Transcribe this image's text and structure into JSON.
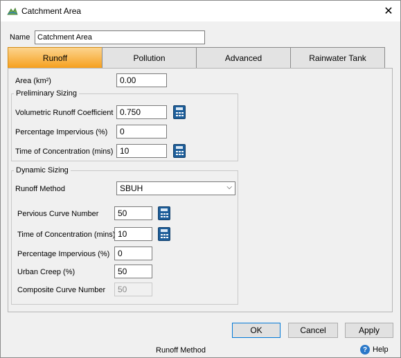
{
  "window": {
    "title": "Catchment Area"
  },
  "name": {
    "label": "Name",
    "value": "Catchment Area"
  },
  "tabs": [
    {
      "label": "Runoff",
      "active": true
    },
    {
      "label": "Pollution",
      "active": false
    },
    {
      "label": "Advanced",
      "active": false
    },
    {
      "label": "Rainwater Tank",
      "active": false
    }
  ],
  "runoff": {
    "area": {
      "label": "Area (km²)",
      "value": "0.00"
    },
    "preliminary": {
      "title": "Preliminary Sizing",
      "runoff_coeff": {
        "label": "Volumetric Runoff Coefficient",
        "value": "0.750"
      },
      "pct_impervious": {
        "label": "Percentage Impervious (%)",
        "value": "0"
      },
      "toc": {
        "label": "Time of Concentration (mins)",
        "value": "10"
      }
    },
    "dynamic": {
      "title": "Dynamic Sizing",
      "method": {
        "label": "Runoff Method",
        "value": "SBUH"
      },
      "pervious_cn": {
        "label": "Pervious Curve Number",
        "value": "50"
      },
      "toc": {
        "label": "Time of Concentration (mins)",
        "value": "10"
      },
      "pct_impervious": {
        "label": "Percentage Impervious (%)",
        "value": "0"
      },
      "urban_creep": {
        "label": "Urban Creep (%)",
        "value": "50"
      },
      "composite_cn": {
        "label": "Composite Curve Number",
        "value": "50"
      }
    }
  },
  "buttons": {
    "ok": "OK",
    "cancel": "Cancel",
    "apply": "Apply"
  },
  "status": {
    "text": "Runoff Method",
    "help": "Help"
  },
  "icons": {
    "app": "catchment-app-icon",
    "close": "close-icon",
    "calculator": "calculator-icon",
    "chevron": "chevron-down-icon",
    "help": "help-icon"
  },
  "colors": {
    "active_tab": "#f6a01f",
    "calc_icon": "#1d5e9a",
    "help_icon": "#2a78c9"
  }
}
